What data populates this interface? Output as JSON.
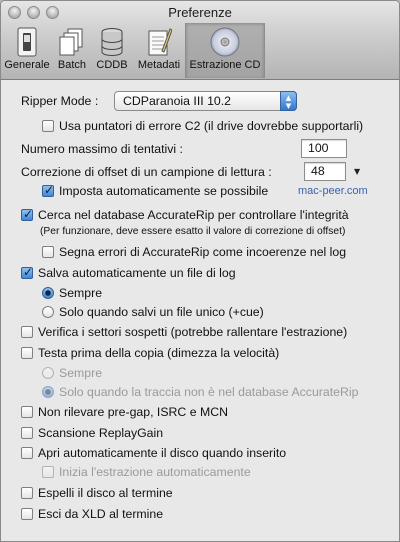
{
  "window": {
    "title": "Preferenze"
  },
  "toolbar": {
    "items": [
      {
        "label": "Generale",
        "icon": "switch-icon"
      },
      {
        "label": "Batch",
        "icon": "documents-icon"
      },
      {
        "label": "CDDB",
        "icon": "database-icon"
      },
      {
        "label": "Metadati",
        "icon": "notepad-icon"
      },
      {
        "label": "Estrazione CD",
        "icon": "cd-icon",
        "selected": true
      }
    ]
  },
  "ripper": {
    "label": "Ripper Mode :",
    "value": "CDParanoia III 10.2"
  },
  "options": {
    "c2": {
      "label": "Usa puntatori di errore C2 (il drive dovrebbe supportarli)",
      "checked": false
    },
    "max_retries": {
      "label": "Numero massimo di tentativi :",
      "value": "100"
    },
    "offset": {
      "label": "Correzione di offset di un campione di lettura :",
      "value": "48"
    },
    "auto_offset": {
      "label": "Imposta automaticamente se possibile",
      "checked": true
    },
    "watermark": "mac-peer.com",
    "accuraterip": {
      "label": "Cerca nel database AccurateRip per controllare l'integrità",
      "checked": true,
      "note": "(Per funzionare, deve essere esatto il valore di correzione di offset)"
    },
    "mark_errors": {
      "label": "Segna errori di AccurateRip come incoerenze nel log",
      "checked": false
    },
    "save_log": {
      "label": "Salva automaticamente un file di log",
      "checked": true
    },
    "log_always": {
      "label": "Sempre",
      "checked": true
    },
    "log_single": {
      "label": "Solo quando salvi un file unico (+cue)",
      "checked": false
    },
    "verify": {
      "label": "Verifica i settori sospetti (potrebbe rallentare l'estrazione)",
      "checked": false
    },
    "test_first": {
      "label": "Testa prima della copia (dimezza la velocità)",
      "checked": false
    },
    "test_always": {
      "label": "Sempre",
      "checked": false,
      "disabled": true
    },
    "test_not_in_db": {
      "label": "Solo quando la traccia non è nel database AccurateRip",
      "checked": true,
      "disabled": true
    },
    "no_pregap": {
      "label": "Non rilevare pre-gap, ISRC e MCN",
      "checked": false
    },
    "replaygain": {
      "label": "Scansione ReplayGain",
      "checked": false
    },
    "auto_open": {
      "label": "Apri automaticamente il disco quando inserito",
      "checked": false
    },
    "auto_start": {
      "label": "Inizia l'estrazione automaticamente",
      "checked": false,
      "disabled": true
    },
    "eject": {
      "label": "Espelli il disco al termine",
      "checked": false
    },
    "quit": {
      "label": "Esci da XLD al termine",
      "checked": false
    }
  }
}
